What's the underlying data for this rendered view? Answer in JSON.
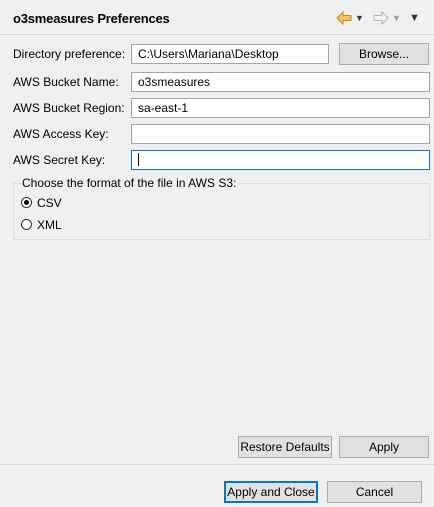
{
  "header": {
    "title": "o3smeasures Preferences"
  },
  "nav": {
    "back_icon": "arrow-left-icon",
    "back_menu_icon": "chevron-down-icon",
    "forward_icon": "arrow-right-icon",
    "forward_menu_icon": "chevron-down-icon",
    "view_menu_icon": "view-menu-icon",
    "back_color": "#e8a317",
    "arrow_glyph_down": "▼"
  },
  "form": {
    "directory": {
      "label": "Directory preference:",
      "value": "C:\\Users\\Mariana\\Desktop",
      "browse_label": "Browse..."
    },
    "bucket_name": {
      "label": "AWS Bucket Name:",
      "value": "o3smeasures"
    },
    "bucket_region": {
      "label": "AWS Bucket Region:",
      "value": "sa-east-1"
    },
    "access_key": {
      "label": "AWS Access Key:",
      "value": ""
    },
    "secret_key": {
      "label": "AWS Secret Key:",
      "value": ""
    }
  },
  "format_group": {
    "legend": "Choose the format of the file in AWS S3:",
    "options": [
      {
        "label": "CSV",
        "checked": true
      },
      {
        "label": "XML",
        "checked": false
      }
    ]
  },
  "buttons": {
    "restore_defaults": "Restore Defaults",
    "apply": "Apply",
    "apply_and_close": "Apply and Close",
    "cancel": "Cancel"
  },
  "colors": {
    "background": "#f0f0f0",
    "focus_border": "#0078d7",
    "button_face": "#e1e1e1"
  }
}
